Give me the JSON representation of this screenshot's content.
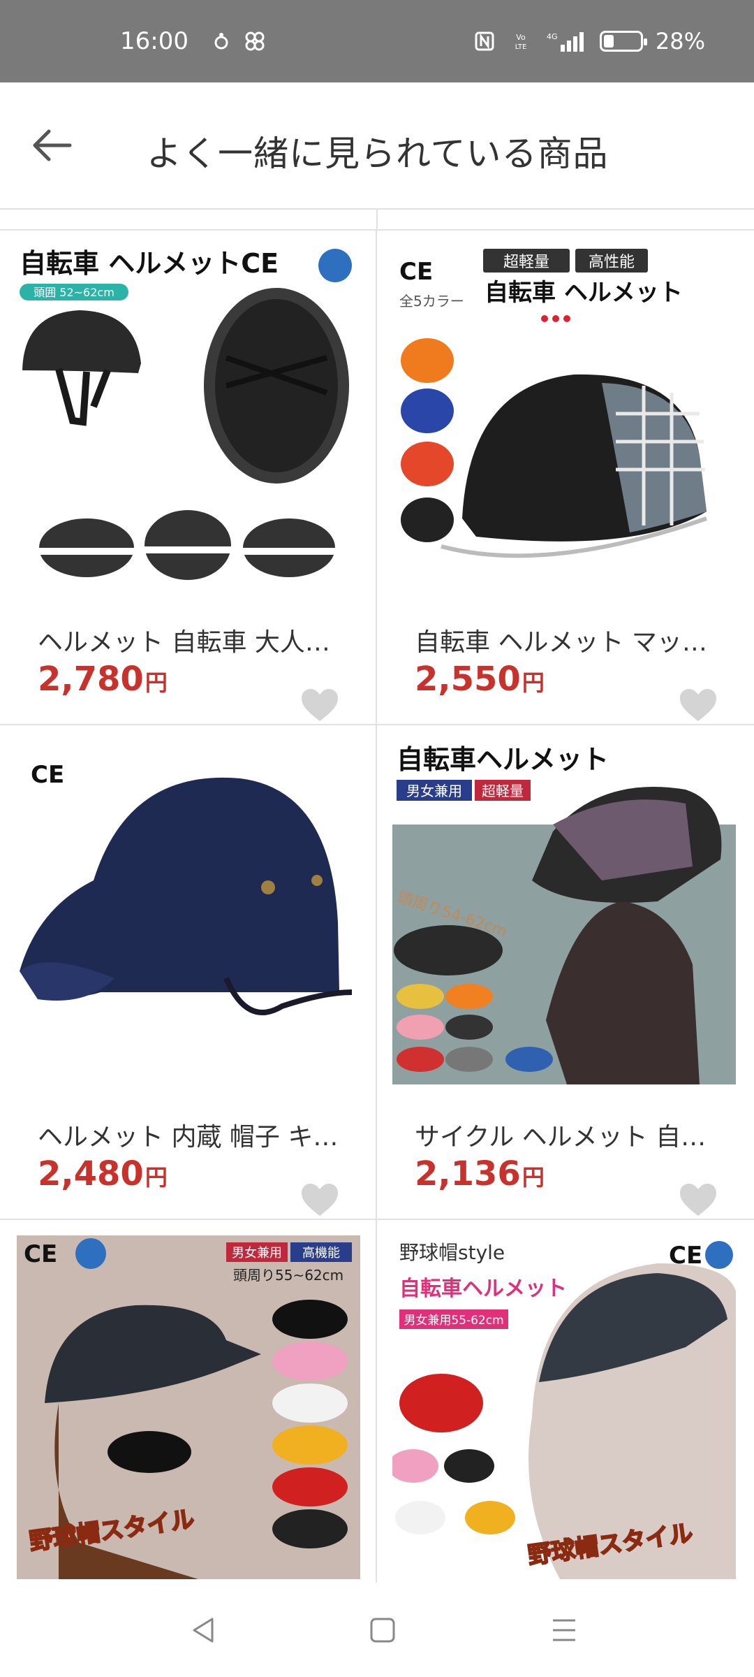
{
  "status_bar": {
    "time": "16:00",
    "left_icons": [
      "notification-icon",
      "pinwheel-icon"
    ],
    "right_icons": [
      "nfc-icon",
      "volte-icon",
      "4g-signal-icon"
    ],
    "battery_percent": "28%",
    "battery_level": 0.28
  },
  "header": {
    "title": "よく一緒に見られている商品"
  },
  "products": [
    {
      "name": "ヘルメット 自転車 大人用...",
      "price": "2,780",
      "currency": "円",
      "image_texts": [
        "自転車 ヘルメットCE",
        "頭囲 52~62cm"
      ]
    },
    {
      "name": "自転車 ヘルメット マット...",
      "price": "2,550",
      "currency": "円",
      "image_texts": [
        "超軽量",
        "高性能",
        "自転車 ヘルメット",
        "CE",
        "全5カラー"
      ]
    },
    {
      "name": "ヘルメット 内蔵 帽子 キャ...",
      "price": "2,480",
      "currency": "円",
      "image_texts": [
        "CE"
      ]
    },
    {
      "name": "サイクル ヘルメット 自転...",
      "price": "2,136",
      "currency": "円",
      "image_texts": [
        "自転車ヘルメット",
        "男女兼用",
        "超軽量",
        "頭周り54-62cm"
      ]
    },
    {
      "name": "",
      "price": "",
      "currency": "",
      "image_texts": [
        "CE",
        "男女兼用",
        "高機能",
        "頭周り55~62cm",
        "野球帽スタイル"
      ]
    },
    {
      "name": "",
      "price": "",
      "currency": "",
      "image_texts": [
        "野球帽style",
        "自転車ヘルメット",
        "男女兼用55-62cm",
        "CE",
        "野球帽スタイル"
      ]
    }
  ],
  "colors": {
    "price": "#c7332c",
    "status_bar_bg": "#7a7a7a",
    "heart": "#d4d4d4"
  }
}
